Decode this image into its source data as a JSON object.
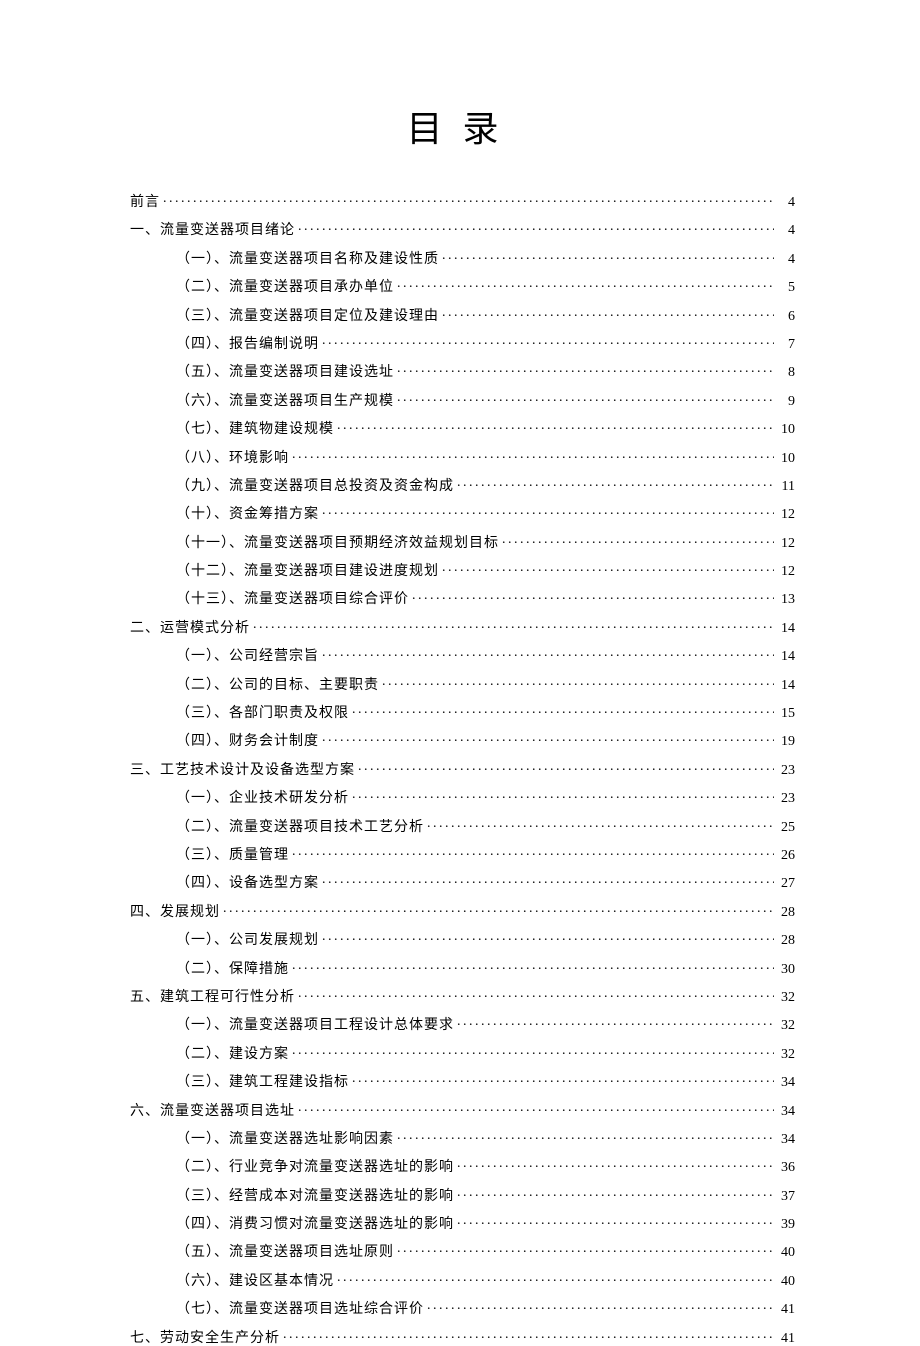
{
  "title": "目录",
  "toc": [
    {
      "level": 0,
      "label": "前言",
      "page": "4"
    },
    {
      "level": 0,
      "label": "一、流量变送器项目绪论",
      "page": "4"
    },
    {
      "level": 1,
      "label": "（一）、流量变送器项目名称及建设性质",
      "page": "4"
    },
    {
      "level": 1,
      "label": "（二）、流量变送器项目承办单位",
      "page": "5"
    },
    {
      "level": 1,
      "label": "（三）、流量变送器项目定位及建设理由",
      "page": "6"
    },
    {
      "level": 1,
      "label": "（四）、报告编制说明",
      "page": "7"
    },
    {
      "level": 1,
      "label": "（五）、流量变送器项目建设选址",
      "page": "8"
    },
    {
      "level": 1,
      "label": "（六）、流量变送器项目生产规模",
      "page": "9"
    },
    {
      "level": 1,
      "label": "（七）、建筑物建设规模",
      "page": "10"
    },
    {
      "level": 1,
      "label": "（八）、环境影响",
      "page": "10"
    },
    {
      "level": 1,
      "label": "（九）、流量变送器项目总投资及资金构成",
      "page": "11"
    },
    {
      "level": 1,
      "label": "（十）、资金筹措方案",
      "page": "12"
    },
    {
      "level": 1,
      "label": "（十一）、流量变送器项目预期经济效益规划目标",
      "page": "12"
    },
    {
      "level": 1,
      "label": "（十二）、流量变送器项目建设进度规划",
      "page": "12"
    },
    {
      "level": 1,
      "label": "（十三）、流量变送器项目综合评价",
      "page": "13"
    },
    {
      "level": 0,
      "label": "二、运营模式分析",
      "page": "14"
    },
    {
      "level": 1,
      "label": "（一）、公司经营宗旨",
      "page": "14"
    },
    {
      "level": 1,
      "label": "（二）、公司的目标、主要职责",
      "page": "14"
    },
    {
      "level": 1,
      "label": "（三）、各部门职责及权限",
      "page": "15"
    },
    {
      "level": 1,
      "label": "（四）、财务会计制度",
      "page": "19"
    },
    {
      "level": 0,
      "label": "三、工艺技术设计及设备选型方案",
      "page": "23"
    },
    {
      "level": 1,
      "label": "（一）、企业技术研发分析",
      "page": "23"
    },
    {
      "level": 1,
      "label": "（二）、流量变送器项目技术工艺分析",
      "page": "25"
    },
    {
      "level": 1,
      "label": "（三）、质量管理",
      "page": "26"
    },
    {
      "level": 1,
      "label": "（四）、设备选型方案",
      "page": "27"
    },
    {
      "level": 0,
      "label": "四、发展规划",
      "page": "28"
    },
    {
      "level": 1,
      "label": "（一）、公司发展规划",
      "page": "28"
    },
    {
      "level": 1,
      "label": "（二）、保障措施",
      "page": "30"
    },
    {
      "level": 0,
      "label": "五、建筑工程可行性分析",
      "page": "32"
    },
    {
      "level": 1,
      "label": "（一）、流量变送器项目工程设计总体要求",
      "page": "32"
    },
    {
      "level": 1,
      "label": "（二）、建设方案",
      "page": "32"
    },
    {
      "level": 1,
      "label": "（三）、建筑工程建设指标",
      "page": "34"
    },
    {
      "level": 0,
      "label": "六、流量变送器项目选址",
      "page": "34"
    },
    {
      "level": 1,
      "label": "（一）、流量变送器选址影响因素",
      "page": "34"
    },
    {
      "level": 1,
      "label": "（二）、行业竞争对流量变送器选址的影响",
      "page": "36"
    },
    {
      "level": 1,
      "label": "（三）、经营成本对流量变送器选址的影响",
      "page": "37"
    },
    {
      "level": 1,
      "label": "（四）、消费习惯对流量变送器选址的影响",
      "page": "39"
    },
    {
      "level": 1,
      "label": "（五）、流量变送器项目选址原则",
      "page": "40"
    },
    {
      "level": 1,
      "label": "（六）、建设区基本情况",
      "page": "40"
    },
    {
      "level": 1,
      "label": "（七）、流量变送器项目选址综合评价",
      "page": "41"
    },
    {
      "level": 0,
      "label": "七、劳动安全生产分析",
      "page": "41"
    }
  ]
}
